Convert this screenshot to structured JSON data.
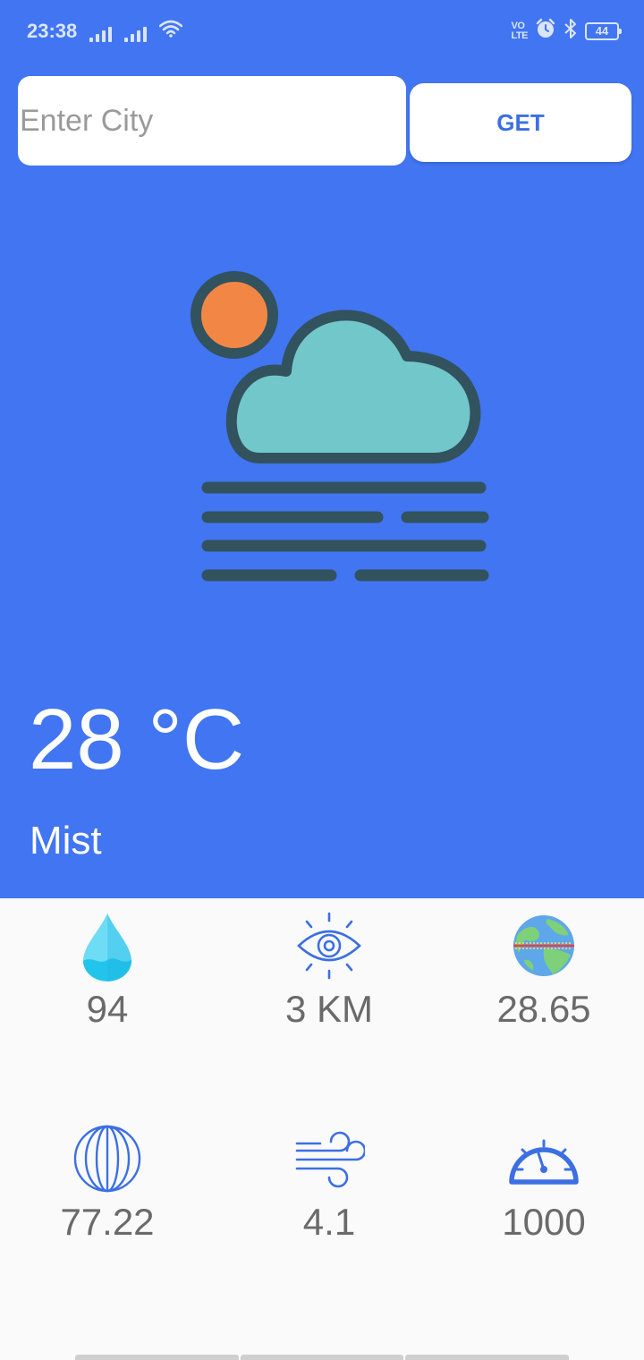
{
  "status_bar": {
    "time": "23:38",
    "battery": "44",
    "icons": [
      "signal-icon",
      "signal-icon",
      "wifi-icon",
      "volte-icon",
      "alarm-icon",
      "bluetooth-icon",
      "battery-icon"
    ]
  },
  "search": {
    "placeholder": "Enter City",
    "value": "",
    "button_label": "GET"
  },
  "weather": {
    "icon": "mist-cloud-sun-icon",
    "temperature": "28 °C",
    "description": "Mist"
  },
  "details": [
    {
      "icon": "humidity-drop-icon",
      "value": "94"
    },
    {
      "icon": "visibility-eye-icon",
      "value": "3 KM"
    },
    {
      "icon": "latitude-globe-icon",
      "value": "28.65"
    },
    {
      "icon": "longitude-sphere-icon",
      "value": "77.22"
    },
    {
      "icon": "wind-icon",
      "value": "4.1"
    },
    {
      "icon": "pressure-gauge-icon",
      "value": "1000"
    }
  ],
  "colors": {
    "primary": "#4175f2",
    "background": "#fafafa",
    "sun": "#f28745",
    "cloud": "#71c7c9",
    "outline": "#32525e"
  }
}
